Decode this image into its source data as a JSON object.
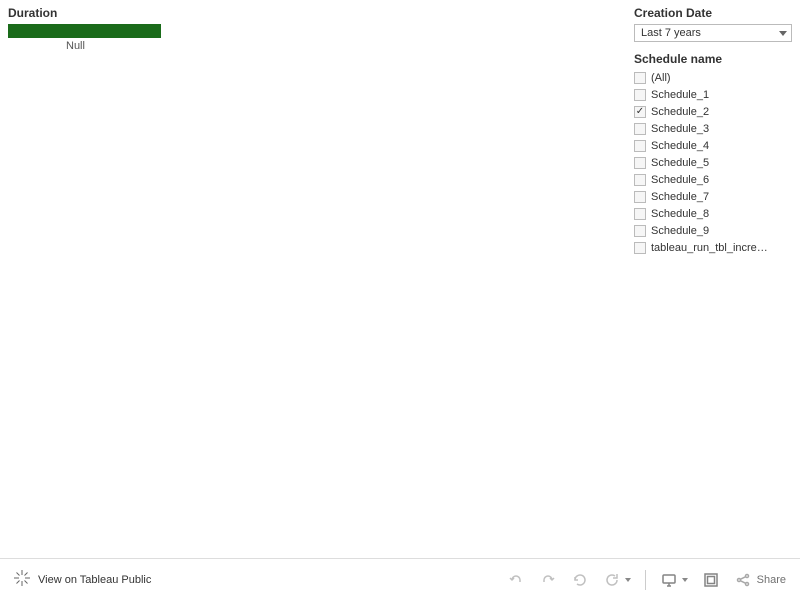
{
  "chart": {
    "title": "Duration",
    "null_label": "Null"
  },
  "chart_data": {
    "type": "bar",
    "categories": [
      "Null"
    ],
    "values": [
      1
    ],
    "title": "Duration",
    "xlabel": "",
    "ylabel": ""
  },
  "filters": {
    "creation_date": {
      "title": "Creation Date",
      "selected": "Last 7 years"
    },
    "schedule": {
      "title": "Schedule name",
      "items": [
        {
          "label": "(All)",
          "checked": false
        },
        {
          "label": "Schedule_1",
          "checked": false
        },
        {
          "label": "Schedule_2",
          "checked": true
        },
        {
          "label": "Schedule_3",
          "checked": false
        },
        {
          "label": "Schedule_4",
          "checked": false
        },
        {
          "label": "Schedule_5",
          "checked": false
        },
        {
          "label": "Schedule_6",
          "checked": false
        },
        {
          "label": "Schedule_7",
          "checked": false
        },
        {
          "label": "Schedule_8",
          "checked": false
        },
        {
          "label": "Schedule_9",
          "checked": false
        },
        {
          "label": "tableau_run_tbl_incre…",
          "checked": false
        }
      ]
    }
  },
  "toolbar": {
    "view_text": "View on Tableau Public",
    "share_text": "Share"
  }
}
